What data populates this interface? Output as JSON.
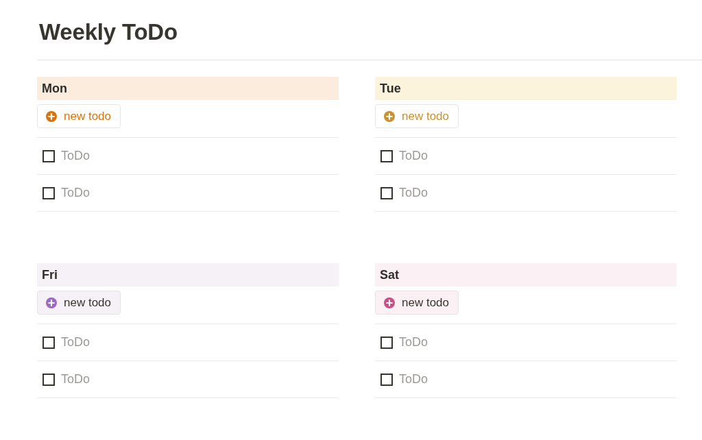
{
  "page": {
    "title": "Weekly ToDo"
  },
  "days": [
    {
      "name": "Mon",
      "color": "#fbecdd",
      "new_button": {
        "label": "new todo",
        "kind": "outline",
        "color": "#d9730d"
      },
      "todos": [
        {
          "text": "ToDo",
          "checked": false
        },
        {
          "text": "ToDo",
          "checked": false
        }
      ]
    },
    {
      "name": "Tue",
      "color": "#fbf3db",
      "new_button": {
        "label": "new todo",
        "kind": "outline",
        "color": "#cb912f"
      },
      "todos": [
        {
          "text": "ToDo",
          "checked": false
        },
        {
          "text": "ToDo",
          "checked": false
        }
      ]
    },
    {
      "name": "Fri",
      "color": "#f6f1f6",
      "new_button": {
        "label": "new todo",
        "kind": "tinted",
        "color": "#9b6bc4"
      },
      "todos": [
        {
          "text": "ToDo",
          "checked": false
        },
        {
          "text": "ToDo",
          "checked": false
        }
      ]
    },
    {
      "name": "Sat",
      "color": "#fbf0f4",
      "new_button": {
        "label": "new todo",
        "kind": "tinted",
        "color": "#c8508a"
      },
      "todos": [
        {
          "text": "ToDo",
          "checked": false
        },
        {
          "text": "ToDo",
          "checked": false
        }
      ]
    }
  ]
}
